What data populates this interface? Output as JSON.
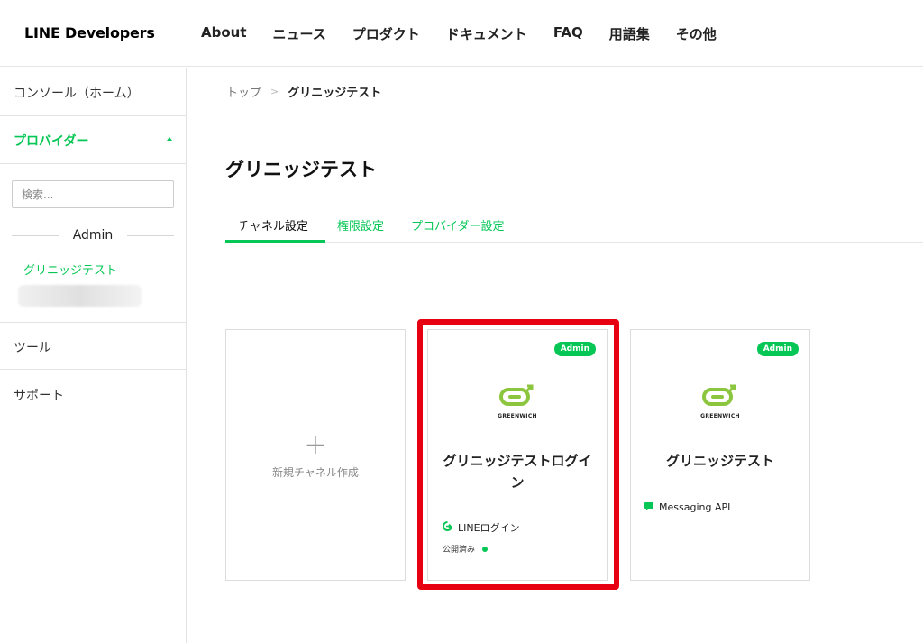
{
  "header": {
    "logo": "LINE Developers",
    "nav": [
      "About",
      "ニュース",
      "プロダクト",
      "ドキュメント",
      "FAQ",
      "用語集",
      "その他"
    ]
  },
  "sidebar": {
    "console": "コンソール（ホーム）",
    "providers": "プロバイダー",
    "search_placeholder": "検索...",
    "role_label": "Admin",
    "provider_item": "グリニッジテスト",
    "tools": "ツール",
    "support": "サポート"
  },
  "breadcrumb": {
    "top": "トップ",
    "separator": ">",
    "current": "グリニッジテスト"
  },
  "page": {
    "title": "グリニッジテスト",
    "tabs": [
      "チャネル設定",
      "権限設定",
      "プロバイダー設定"
    ]
  },
  "cards": {
    "new_channel": {
      "plus": "+",
      "label": "新規チャネル作成"
    },
    "channel1": {
      "badge": "Admin",
      "logo_text": "GREENWICH",
      "title": "グリニッジテストログイン",
      "type": "LINEログイン",
      "status": "公開済み"
    },
    "channel2": {
      "badge": "Admin",
      "logo_text": "GREENWICH",
      "title": "グリニッジテスト",
      "type": "Messaging API"
    }
  },
  "colors": {
    "accent": "#06c755",
    "highlight": "#e60012"
  }
}
